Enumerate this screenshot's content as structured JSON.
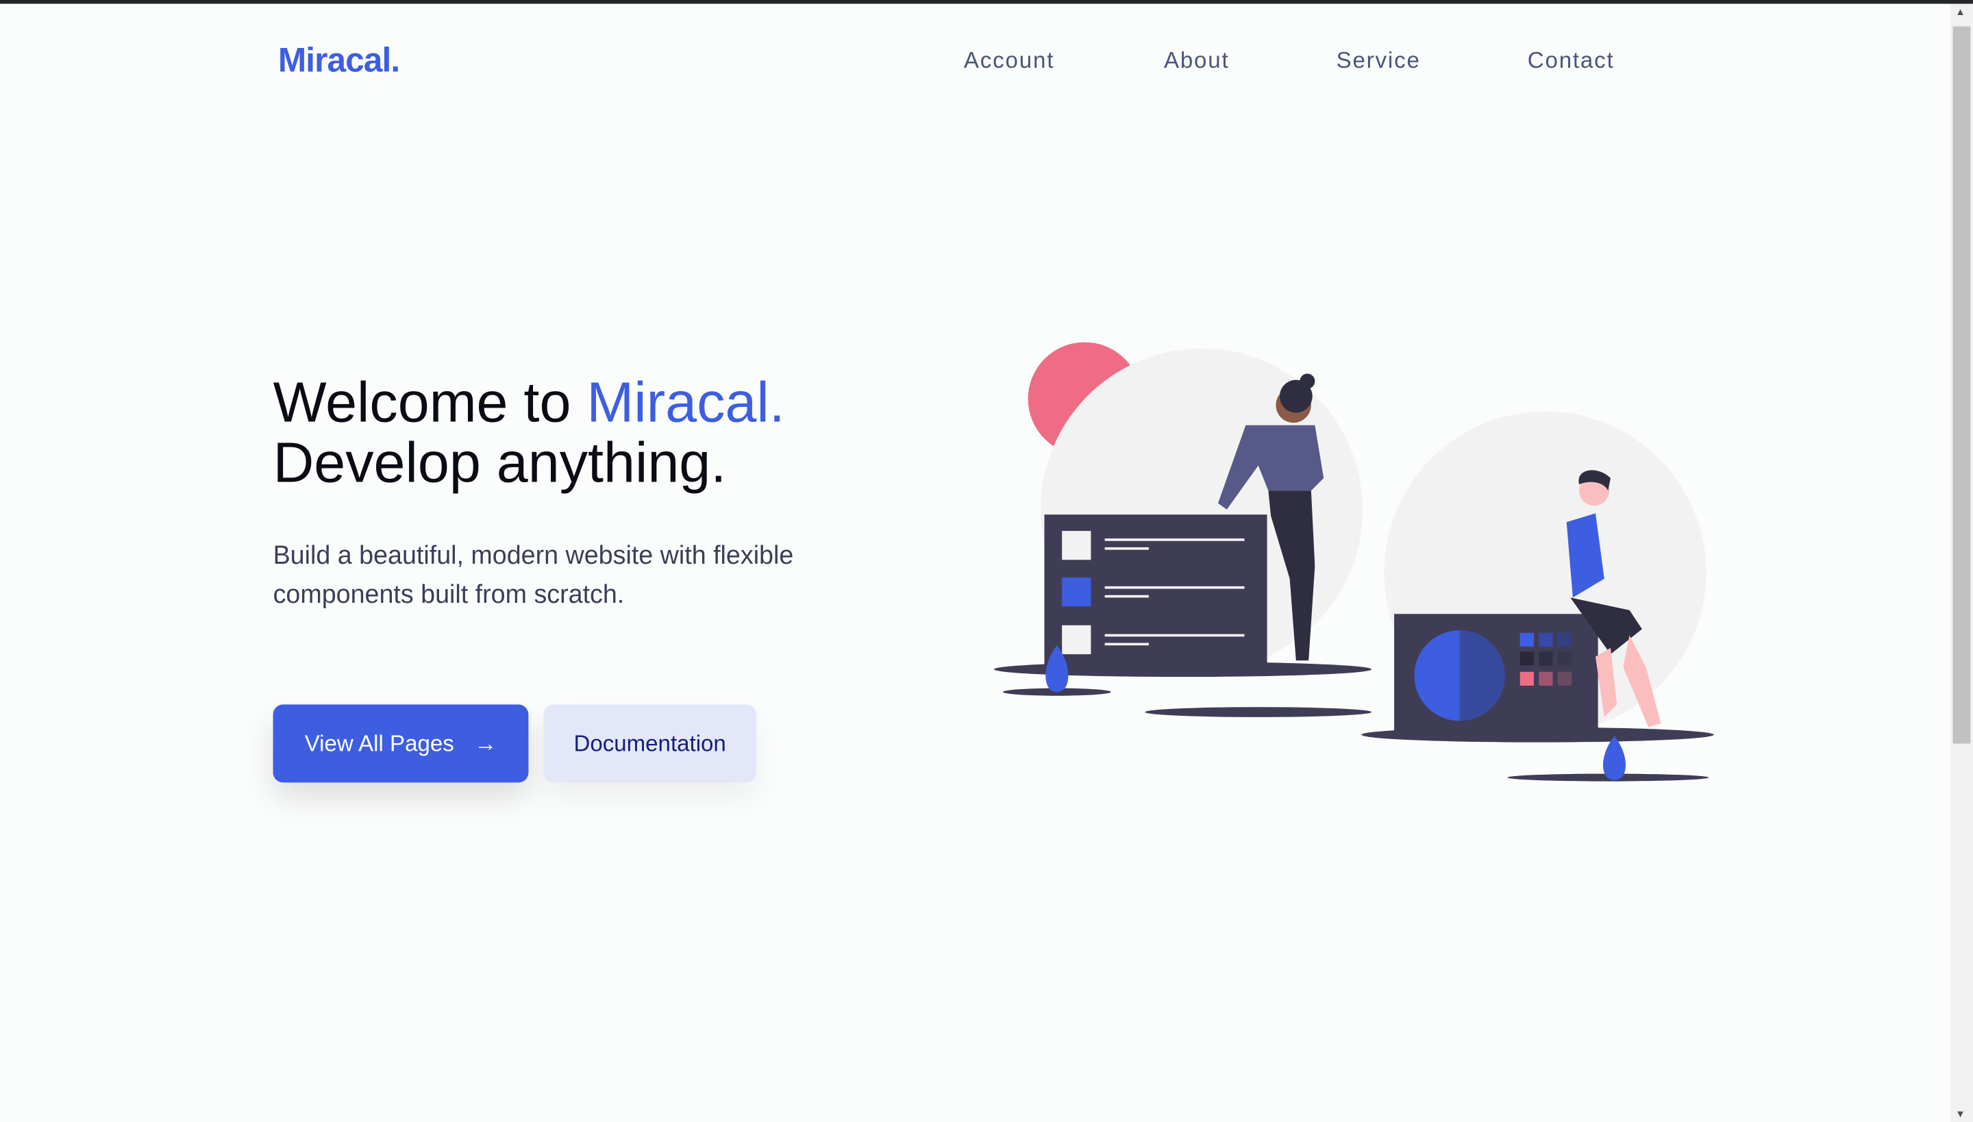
{
  "header": {
    "logo": "Miracal.",
    "nav": [
      "Account",
      "About",
      "Service",
      "Contact"
    ]
  },
  "hero": {
    "title_prefix": "Welcome to ",
    "title_accent": "Miracal.",
    "title_line2": "Develop anything.",
    "lead": "Build a beautiful, modern website with flexible components built from scratch.",
    "primary_button": "View All Pages",
    "primary_button_icon": "arrow-right-icon",
    "secondary_button": "Documentation"
  },
  "colors": {
    "accent": "#3d5ee1",
    "secondary_bg": "#e3e7f9",
    "secondary_text": "#14207a",
    "illustration_dark": "#3f3d56",
    "illustration_pink": "#ee6c84"
  }
}
